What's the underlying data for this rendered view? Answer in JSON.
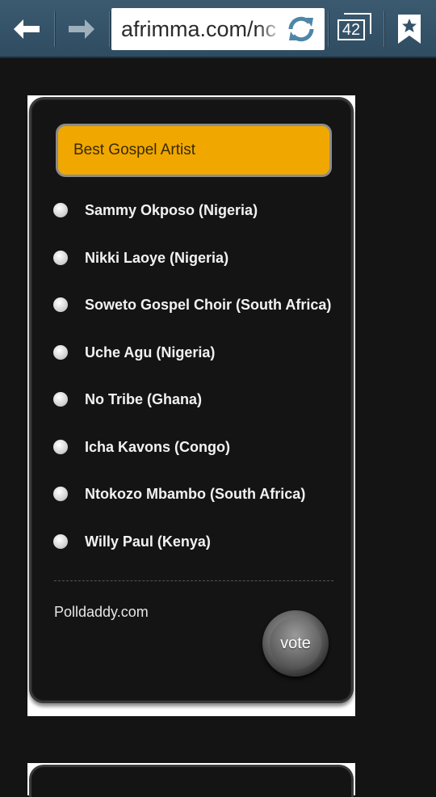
{
  "browser": {
    "url": "afrimma.com/nc",
    "tab_count": "42",
    "icons": {
      "back": "arrow-left-icon",
      "forward": "arrow-right-icon",
      "reload": "reload-icon",
      "tabs": "tabs-icon",
      "bookmark": "bookmark-star-icon"
    }
  },
  "poll": {
    "question": "Best Gospel Artist",
    "options": [
      {
        "label": "Sammy Okposo (Nigeria)"
      },
      {
        "label": "Nikki Laoye (Nigeria)"
      },
      {
        "label": "Soweto Gospel Choir (South Africa)"
      },
      {
        "label": "Uche Agu (Nigeria)"
      },
      {
        "label": "No Tribe (Ghana)"
      },
      {
        "label": "Icha Kavons (Congo)"
      },
      {
        "label": "Ntokozo Mbambo (South Africa)"
      },
      {
        "label": "Willy Paul (Kenya)"
      }
    ],
    "brand": "Polldaddy.com",
    "vote_label": "vote"
  },
  "colors": {
    "toolbar": "#34536a",
    "page_background": "#141414",
    "question_background": "#f0a800"
  }
}
